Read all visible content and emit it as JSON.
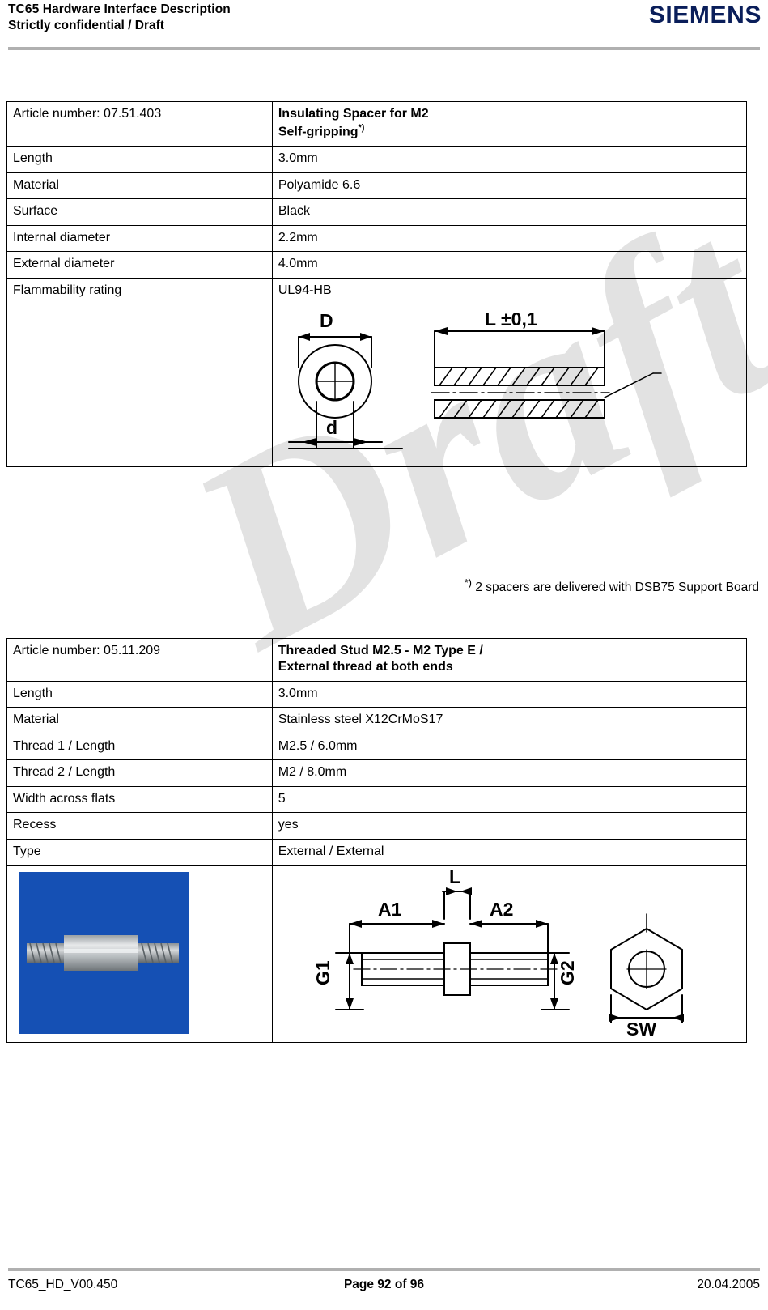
{
  "header": {
    "title": "TC65 Hardware Interface Description",
    "subtitle": "Strictly confidential / Draft",
    "logo": "SIEMENS"
  },
  "footer": {
    "document_id": "TC65_HD_V00.450",
    "page": "Page 92 of 96",
    "date": "20.04.2005"
  },
  "watermark": {
    "text": "Draft"
  },
  "table1": {
    "rows": [
      {
        "label": "Article number: 07.51.403",
        "value_line1": "Insulating Spacer for M2",
        "value_line2": "Self-gripping",
        "value_sup": "*)",
        "value_bold": true
      },
      {
        "label": "Length",
        "value": "3.0mm"
      },
      {
        "label": "Material",
        "value": "Polyamide 6.6"
      },
      {
        "label": "Surface",
        "value": "Black"
      },
      {
        "label": "Internal diameter",
        "value": "2.2mm"
      },
      {
        "label": "External diameter",
        "value": "4.0mm"
      },
      {
        "label": "Flammability rating",
        "value": "UL94-HB"
      }
    ],
    "figure": {
      "name": "insulating-spacer-drawing",
      "labels": {
        "diameter_outer": "D",
        "diameter_inner": "d",
        "length": "L  ±0,1"
      }
    }
  },
  "footnote1": {
    "marker": "*)",
    "text": "2 spacers are delivered with DSB75 Support Board"
  },
  "table2": {
    "rows": [
      {
        "label": "Article number: 05.11.209",
        "value_line1": "Threaded Stud M2.5 - M2 Type E /",
        "value_line2": "External thread at both ends",
        "value_bold": true
      },
      {
        "label": "Length",
        "value": "3.0mm"
      },
      {
        "label": "Material",
        "value": "Stainless steel X12CrMoS17"
      },
      {
        "label": "Thread 1 / Length",
        "value": "M2.5 / 6.0mm"
      },
      {
        "label": "Thread 2 / Length",
        "value": "M2 / 8.0mm"
      },
      {
        "label": "Width across flats",
        "value": "5"
      },
      {
        "label": "Recess",
        "value": "yes"
      },
      {
        "label": "Type",
        "value": "External / External"
      }
    ],
    "photo": {
      "name": "threaded-stud-photo"
    },
    "figure": {
      "name": "threaded-stud-drawing",
      "labels": {
        "length": "L",
        "a1": "A1",
        "a2": "A2",
        "g1": "G1",
        "g2": "G2",
        "sw": "SW"
      }
    }
  }
}
